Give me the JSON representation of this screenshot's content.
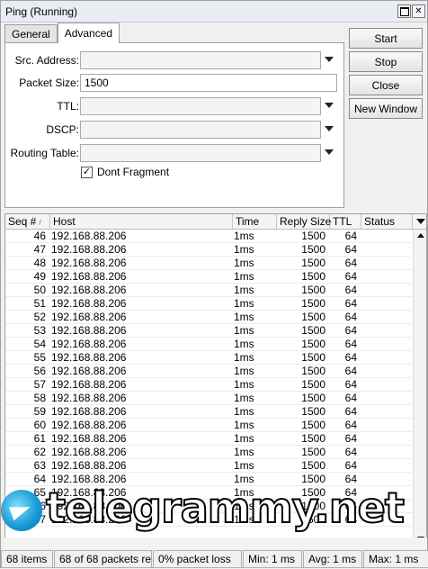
{
  "window": {
    "title": "Ping (Running)"
  },
  "tabs": [
    {
      "label": "General"
    },
    {
      "label": "Advanced"
    }
  ],
  "form": {
    "src_address": {
      "label": "Src. Address:",
      "value": ""
    },
    "packet_size": {
      "label": "Packet Size:",
      "value": "1500"
    },
    "ttl": {
      "label": "TTL:",
      "value": ""
    },
    "dscp": {
      "label": "DSCP:",
      "value": ""
    },
    "routing_table": {
      "label": "Routing Table:",
      "value": ""
    },
    "dont_fragment": {
      "label": "Dont Fragment",
      "checked": true
    }
  },
  "buttons": {
    "start": "Start",
    "stop": "Stop",
    "close": "Close",
    "new_window": "New Window"
  },
  "table": {
    "columns": {
      "seq": "Seq #",
      "host": "Host",
      "time": "Time",
      "reply_size": "Reply Size",
      "ttl": "TTL",
      "status": "Status"
    },
    "rows": [
      {
        "seq": "46",
        "host": "192.168.88.206",
        "time": "1ms",
        "reply": "1500",
        "ttl": "64",
        "status": ""
      },
      {
        "seq": "47",
        "host": "192.168.88.206",
        "time": "1ms",
        "reply": "1500",
        "ttl": "64",
        "status": ""
      },
      {
        "seq": "48",
        "host": "192.168.88.206",
        "time": "1ms",
        "reply": "1500",
        "ttl": "64",
        "status": ""
      },
      {
        "seq": "49",
        "host": "192.168.88.206",
        "time": "1ms",
        "reply": "1500",
        "ttl": "64",
        "status": ""
      },
      {
        "seq": "50",
        "host": "192.168.88.206",
        "time": "1ms",
        "reply": "1500",
        "ttl": "64",
        "status": ""
      },
      {
        "seq": "51",
        "host": "192.168.88.206",
        "time": "1ms",
        "reply": "1500",
        "ttl": "64",
        "status": ""
      },
      {
        "seq": "52",
        "host": "192.168.88.206",
        "time": "1ms",
        "reply": "1500",
        "ttl": "64",
        "status": ""
      },
      {
        "seq": "53",
        "host": "192.168.88.206",
        "time": "1ms",
        "reply": "1500",
        "ttl": "64",
        "status": ""
      },
      {
        "seq": "54",
        "host": "192.168.88.206",
        "time": "1ms",
        "reply": "1500",
        "ttl": "64",
        "status": ""
      },
      {
        "seq": "55",
        "host": "192.168.88.206",
        "time": "1ms",
        "reply": "1500",
        "ttl": "64",
        "status": ""
      },
      {
        "seq": "56",
        "host": "192.168.88.206",
        "time": "1ms",
        "reply": "1500",
        "ttl": "64",
        "status": ""
      },
      {
        "seq": "57",
        "host": "192.168.88.206",
        "time": "1ms",
        "reply": "1500",
        "ttl": "64",
        "status": ""
      },
      {
        "seq": "58",
        "host": "192.168.88.206",
        "time": "1ms",
        "reply": "1500",
        "ttl": "64",
        "status": ""
      },
      {
        "seq": "59",
        "host": "192.168.88.206",
        "time": "1ms",
        "reply": "1500",
        "ttl": "64",
        "status": ""
      },
      {
        "seq": "60",
        "host": "192.168.88.206",
        "time": "1ms",
        "reply": "1500",
        "ttl": "64",
        "status": ""
      },
      {
        "seq": "61",
        "host": "192.168.88.206",
        "time": "1ms",
        "reply": "1500",
        "ttl": "64",
        "status": ""
      },
      {
        "seq": "62",
        "host": "192.168.88.206",
        "time": "1ms",
        "reply": "1500",
        "ttl": "64",
        "status": ""
      },
      {
        "seq": "63",
        "host": "192.168.88.206",
        "time": "1ms",
        "reply": "1500",
        "ttl": "64",
        "status": ""
      },
      {
        "seq": "64",
        "host": "192.168.88.206",
        "time": "1ms",
        "reply": "1500",
        "ttl": "64",
        "status": ""
      },
      {
        "seq": "65",
        "host": "192.168.88.206",
        "time": "1ms",
        "reply": "1500",
        "ttl": "64",
        "status": ""
      },
      {
        "seq": "66",
        "host": "192.168.88.206",
        "time": "1ms",
        "reply": "1500",
        "ttl": "64",
        "status": ""
      },
      {
        "seq": "67",
        "host": "192.168.88.206",
        "time": "1ms",
        "reply": "1500",
        "ttl": "64",
        "status": ""
      }
    ]
  },
  "statusbar": {
    "items": "68 items",
    "packets": "68 of 68 packets re...",
    "loss": "0% packet loss",
    "min": "Min: 1 ms",
    "avg": "Avg: 1 ms",
    "max": "Max: 1 ms"
  },
  "watermark": {
    "text": "telegrammy.net"
  },
  "icons": {
    "window_max": "maximize-icon",
    "window_close": "close-icon",
    "dropdown": "chevron-down-icon",
    "sort": "sort-icon"
  }
}
